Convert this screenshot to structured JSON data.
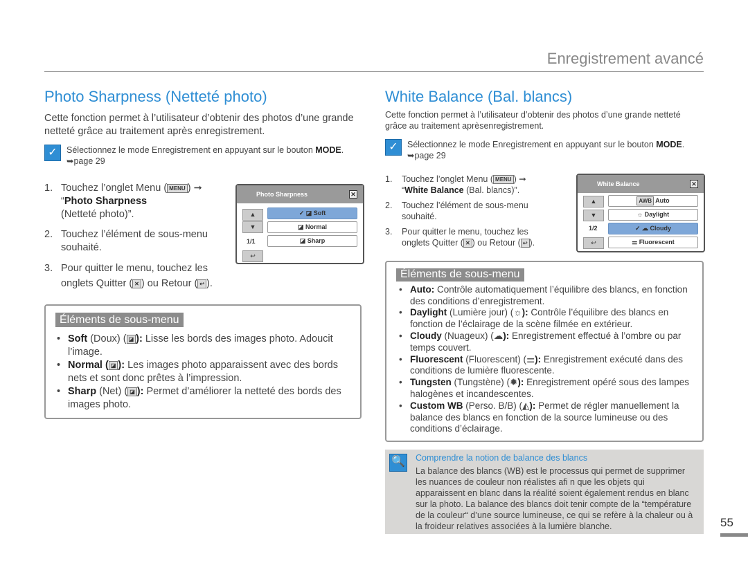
{
  "header": {
    "section_title": "Enregistrement avancé",
    "page_number": "55"
  },
  "left": {
    "title": "Photo Sharpness (Netteté photo)",
    "intro": "Cette fonction permet à l’utilisateur d’obtenir des photos d’une grande netteté grâce au traitement après enregistrement.",
    "note": {
      "text": "Sélectionnez le mode Enregistrement en appuyant sur le bouton ",
      "bold": "MODE",
      "page_ref": "➥page 29"
    },
    "steps": [
      {
        "n": "1.",
        "a": "Touchez l’onglet Menu (",
        "menu_icon": "MENU",
        "b": ") ➞",
        "c": "“",
        "bold": "Photo Sharpness",
        "d": "(Netteté photo)”."
      },
      {
        "n": "2.",
        "text": "Touchez l’élément de sous-menu souhaité."
      },
      {
        "n": "3.",
        "a": "Pour quitter le menu, touchez les onglets Quitter (",
        "b": ") ou Retour (",
        "c": ")."
      }
    ],
    "screen": {
      "title": "Photo Sharpness",
      "page": "1/1",
      "items": [
        "Soft",
        "Normal",
        "Sharp"
      ],
      "selected": "Soft"
    },
    "submenu": {
      "heading": "Éléments de sous-menu",
      "items": [
        {
          "bold": "Soft",
          "paren": " (Doux) (",
          "bold2": "):",
          "text": " Lisse les bords des images photo. Adoucit l’image."
        },
        {
          "bold": "Normal (",
          "paren": "",
          "bold2": "):",
          "text": " Les images photo apparaissent avec des bords nets et sont donc prêtes à l’impression."
        },
        {
          "bold": "Sharp",
          "paren": " (Net) (",
          "bold2": "):",
          "text": " Permet d’améliorer la netteté des bords des images photo."
        }
      ]
    }
  },
  "right": {
    "title": "White Balance (Bal. blancs)",
    "intro": "Cette fonction permet à l’utilisateur d’obtenir des photos d’une grande netteté grâce au traitement aprèsenregistrement.",
    "note": {
      "text": "Sélectionnez le mode Enregistrement en appuyant sur le bouton ",
      "bold": "MODE",
      "page_ref": "➥page 29"
    },
    "steps": [
      {
        "n": "1.",
        "a": "Touchez l’onglet Menu (",
        "menu_icon": "MENU",
        "b": ") ➞",
        "c": "“",
        "bold": "White Balance",
        "d": " (Bal. blancs)”."
      },
      {
        "n": "2.",
        "text": "Touchez l’élément de sous-menu souhaité."
      },
      {
        "n": "3.",
        "a": "Pour quitter le menu, touchez les onglets Quitter (",
        "b": ") ou Retour (",
        "c": ")."
      }
    ],
    "screen": {
      "title": "White Balance",
      "page": "1/2",
      "items": [
        "Auto",
        "Daylight",
        "Cloudy",
        "Fluorescent"
      ],
      "selected": "Cloudy",
      "awb": "AWB"
    },
    "submenu": {
      "heading": "Éléments de sous-menu",
      "items": [
        {
          "bold": "Auto:",
          "paren": "",
          "bold2": "",
          "text": " Contrôle automatiquement l’équilibre des blancs, en fonction des conditions d’enregistrement."
        },
        {
          "bold": "Daylight",
          "paren": " (Lumière jour) (",
          "bold2": "):",
          "text": " Contrôle l’équilibre des blancs en fonction de l’éclairage de la scène filmée en extérieur."
        },
        {
          "bold": "Cloudy",
          "paren": " (Nuageux) (",
          "bold2": "):",
          "text": " Enregistrement effectué à l’ombre ou par temps couvert."
        },
        {
          "bold": "Fluorescent",
          "paren": " (Fluorescent) (",
          "bold2": "):",
          "text": " Enregistrement exécuté dans des conditions de lumière fluorescente."
        },
        {
          "bold": "Tungsten",
          "paren": " (Tungstène) (",
          "bold2": "):",
          "text": " Enregistrement opéré sous des lampes halogènes et incandescentes."
        },
        {
          "bold": "Custom WB",
          "paren": " (Perso. B/B) (",
          "bold2": "):",
          "text": " Permet de régler manuellement la balance des blancs en fonction de la source lumineuse ou des conditions d’éclairage."
        }
      ]
    },
    "tip": {
      "title": "Comprendre la notion de balance des blancs",
      "text": "La balance des blancs (WB) est le processus qui permet de supprimer les nuances de couleur non réalistes afi n que les objets qui apparaissent en blanc dans la réalité soient également rendus en blanc sur la photo. La balance des blancs doit tenir compte de la “température de la couleur“ d’une source lumineuse, ce qui se refère à la chaleur ou à la froideur relatives associées à la lumière blanche."
    }
  },
  "colors": {
    "accent": "#2f8ed4",
    "section_bg": "#8c8c8c",
    "tip_bg": "#d8d7d5",
    "selected": "#7ea7d8"
  }
}
